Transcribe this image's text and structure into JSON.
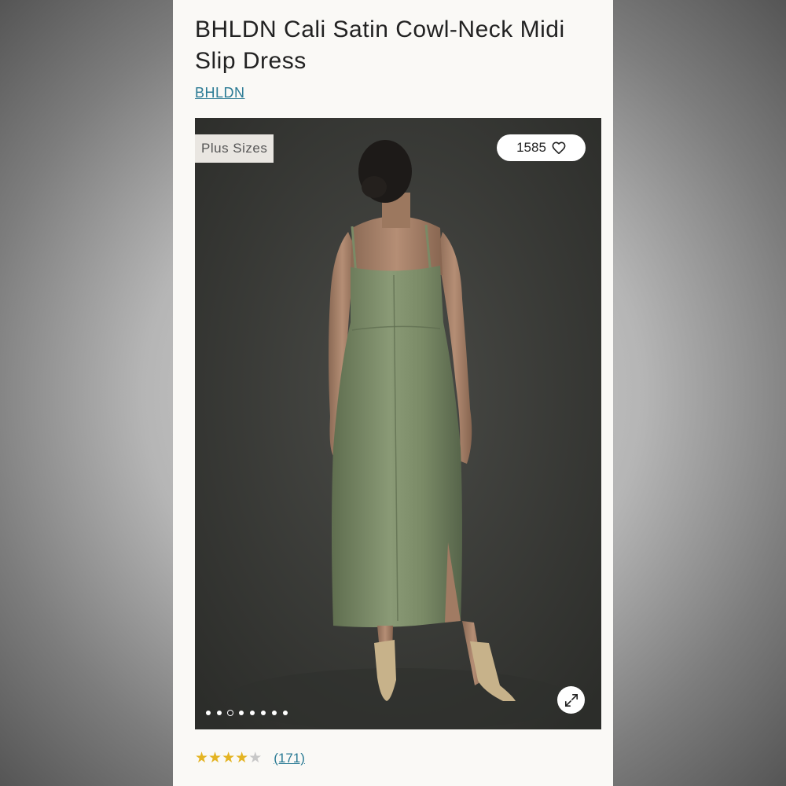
{
  "product": {
    "title": "BHLDN Cali Satin Cowl-Neck Midi Slip Dress",
    "brand": "BHLDN"
  },
  "image": {
    "badge": "Plus Sizes",
    "like_count": "1585",
    "carousel_total": 8,
    "carousel_active_index": 2,
    "colors": {
      "backdrop": "#3b3c39",
      "dress": "#7a8a66"
    }
  },
  "rating": {
    "stars": 4,
    "max": 5,
    "review_count": "(171)",
    "star_color": "#e4b423"
  },
  "icons": {
    "like": "heart-icon",
    "expand": "expand-icon"
  }
}
